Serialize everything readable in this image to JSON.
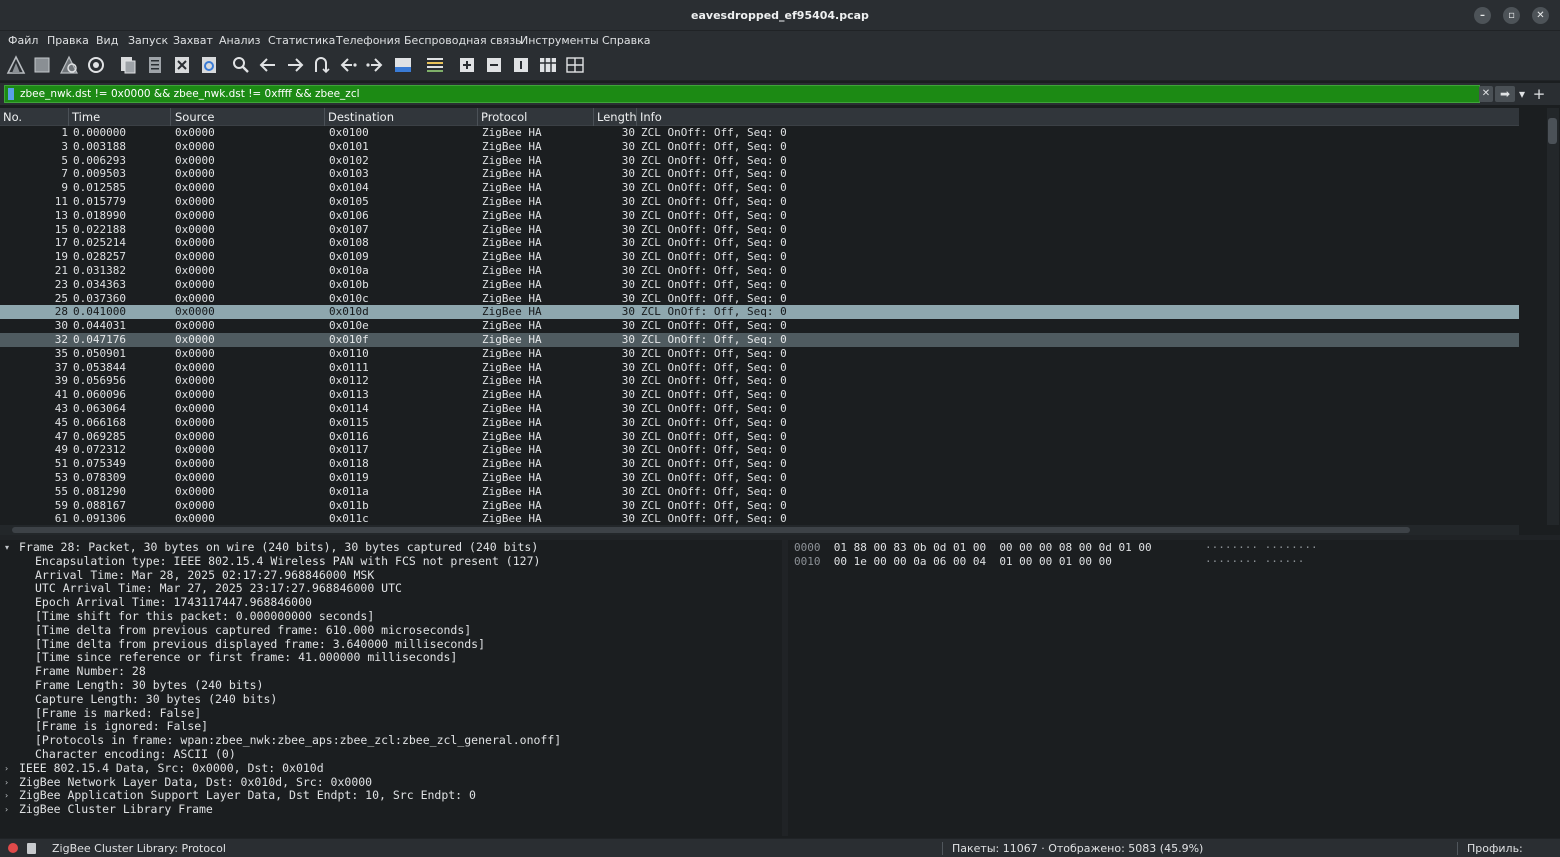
{
  "window": {
    "title": "eavesdropped_ef95404.pcap",
    "minimize": "–",
    "maximize": "▫",
    "close": "✕"
  },
  "menu": [
    "Файл",
    "Правка",
    "Вид",
    "Запуск",
    "Захват",
    "Анализ",
    "Статистика",
    "Телефония",
    "Беспроводная связь",
    "Инструменты",
    "Справка"
  ],
  "toolbar_icons": [
    "shark-start-icon",
    "stop-capture-icon",
    "restart-capture-icon",
    "capture-options-icon",
    "open-file-icon",
    "save-file-icon",
    "close-file-icon",
    "reload-file-icon",
    "find-packet-icon",
    "go-back-icon",
    "go-forward-icon",
    "go-to-packet-icon",
    "first-packet-icon",
    "last-packet-icon",
    "autoscroll-icon",
    "colorize-icon",
    "zoom-in-icon",
    "zoom-out-icon",
    "normal-size-icon",
    "resize-columns-icon",
    "layout-icon"
  ],
  "filter": {
    "expression": "zbee_nwk.dst != 0x0000 && zbee_nwk.dst != 0xffff && zbee_zcl",
    "clear_icon": "✕",
    "apply_icon": "➡",
    "dropdown_icon": "▾",
    "add_icon": "+"
  },
  "columns": [
    "No.",
    "Time",
    "Source",
    "Destination",
    "Protocol",
    "Length",
    "Info"
  ],
  "packets": [
    {
      "no": "1",
      "time": "0.000000",
      "src": "0x0000",
      "dst": "0x0100",
      "proto": "ZigBee HA",
      "len": "30",
      "info": "ZCL OnOff: Off, Seq: 0"
    },
    {
      "no": "3",
      "time": "0.003188",
      "src": "0x0000",
      "dst": "0x0101",
      "proto": "ZigBee HA",
      "len": "30",
      "info": "ZCL OnOff: Off, Seq: 0"
    },
    {
      "no": "5",
      "time": "0.006293",
      "src": "0x0000",
      "dst": "0x0102",
      "proto": "ZigBee HA",
      "len": "30",
      "info": "ZCL OnOff: Off, Seq: 0"
    },
    {
      "no": "7",
      "time": "0.009503",
      "src": "0x0000",
      "dst": "0x0103",
      "proto": "ZigBee HA",
      "len": "30",
      "info": "ZCL OnOff: Off, Seq: 0"
    },
    {
      "no": "9",
      "time": "0.012585",
      "src": "0x0000",
      "dst": "0x0104",
      "proto": "ZigBee HA",
      "len": "30",
      "info": "ZCL OnOff: Off, Seq: 0"
    },
    {
      "no": "11",
      "time": "0.015779",
      "src": "0x0000",
      "dst": "0x0105",
      "proto": "ZigBee HA",
      "len": "30",
      "info": "ZCL OnOff: Off, Seq: 0"
    },
    {
      "no": "13",
      "time": "0.018990",
      "src": "0x0000",
      "dst": "0x0106",
      "proto": "ZigBee HA",
      "len": "30",
      "info": "ZCL OnOff: Off, Seq: 0"
    },
    {
      "no": "15",
      "time": "0.022188",
      "src": "0x0000",
      "dst": "0x0107",
      "proto": "ZigBee HA",
      "len": "30",
      "info": "ZCL OnOff: Off, Seq: 0"
    },
    {
      "no": "17",
      "time": "0.025214",
      "src": "0x0000",
      "dst": "0x0108",
      "proto": "ZigBee HA",
      "len": "30",
      "info": "ZCL OnOff: Off, Seq: 0"
    },
    {
      "no": "19",
      "time": "0.028257",
      "src": "0x0000",
      "dst": "0x0109",
      "proto": "ZigBee HA",
      "len": "30",
      "info": "ZCL OnOff: Off, Seq: 0"
    },
    {
      "no": "21",
      "time": "0.031382",
      "src": "0x0000",
      "dst": "0x010a",
      "proto": "ZigBee HA",
      "len": "30",
      "info": "ZCL OnOff: Off, Seq: 0"
    },
    {
      "no": "23",
      "time": "0.034363",
      "src": "0x0000",
      "dst": "0x010b",
      "proto": "ZigBee HA",
      "len": "30",
      "info": "ZCL OnOff: Off, Seq: 0"
    },
    {
      "no": "25",
      "time": "0.037360",
      "src": "0x0000",
      "dst": "0x010c",
      "proto": "ZigBee HA",
      "len": "30",
      "info": "ZCL OnOff: Off, Seq: 0"
    },
    {
      "no": "28",
      "time": "0.041000",
      "src": "0x0000",
      "dst": "0x010d",
      "proto": "ZigBee HA",
      "len": "30",
      "info": "ZCL OnOff: Off, Seq: 0",
      "state": "selected"
    },
    {
      "no": "30",
      "time": "0.044031",
      "src": "0x0000",
      "dst": "0x010e",
      "proto": "ZigBee HA",
      "len": "30",
      "info": "ZCL OnOff: Off, Seq: 0"
    },
    {
      "no": "32",
      "time": "0.047176",
      "src": "0x0000",
      "dst": "0x010f",
      "proto": "ZigBee HA",
      "len": "30",
      "info": "ZCL OnOff: Off, Seq: 0",
      "state": "hover"
    },
    {
      "no": "35",
      "time": "0.050901",
      "src": "0x0000",
      "dst": "0x0110",
      "proto": "ZigBee HA",
      "len": "30",
      "info": "ZCL OnOff: Off, Seq: 0"
    },
    {
      "no": "37",
      "time": "0.053844",
      "src": "0x0000",
      "dst": "0x0111",
      "proto": "ZigBee HA",
      "len": "30",
      "info": "ZCL OnOff: Off, Seq: 0"
    },
    {
      "no": "39",
      "time": "0.056956",
      "src": "0x0000",
      "dst": "0x0112",
      "proto": "ZigBee HA",
      "len": "30",
      "info": "ZCL OnOff: Off, Seq: 0"
    },
    {
      "no": "41",
      "time": "0.060096",
      "src": "0x0000",
      "dst": "0x0113",
      "proto": "ZigBee HA",
      "len": "30",
      "info": "ZCL OnOff: Off, Seq: 0"
    },
    {
      "no": "43",
      "time": "0.063064",
      "src": "0x0000",
      "dst": "0x0114",
      "proto": "ZigBee HA",
      "len": "30",
      "info": "ZCL OnOff: Off, Seq: 0"
    },
    {
      "no": "45",
      "time": "0.066168",
      "src": "0x0000",
      "dst": "0x0115",
      "proto": "ZigBee HA",
      "len": "30",
      "info": "ZCL OnOff: Off, Seq: 0"
    },
    {
      "no": "47",
      "time": "0.069285",
      "src": "0x0000",
      "dst": "0x0116",
      "proto": "ZigBee HA",
      "len": "30",
      "info": "ZCL OnOff: Off, Seq: 0"
    },
    {
      "no": "49",
      "time": "0.072312",
      "src": "0x0000",
      "dst": "0x0117",
      "proto": "ZigBee HA",
      "len": "30",
      "info": "ZCL OnOff: Off, Seq: 0"
    },
    {
      "no": "51",
      "time": "0.075349",
      "src": "0x0000",
      "dst": "0x0118",
      "proto": "ZigBee HA",
      "len": "30",
      "info": "ZCL OnOff: Off, Seq: 0"
    },
    {
      "no": "53",
      "time": "0.078309",
      "src": "0x0000",
      "dst": "0x0119",
      "proto": "ZigBee HA",
      "len": "30",
      "info": "ZCL OnOff: Off, Seq: 0"
    },
    {
      "no": "55",
      "time": "0.081290",
      "src": "0x0000",
      "dst": "0x011a",
      "proto": "ZigBee HA",
      "len": "30",
      "info": "ZCL OnOff: Off, Seq: 0"
    },
    {
      "no": "59",
      "time": "0.088167",
      "src": "0x0000",
      "dst": "0x011b",
      "proto": "ZigBee HA",
      "len": "30",
      "info": "ZCL OnOff: Off, Seq: 0"
    },
    {
      "no": "61",
      "time": "0.091306",
      "src": "0x0000",
      "dst": "0x011c",
      "proto": "ZigBee HA",
      "len": "30",
      "info": "ZCL OnOff: Off, Seq: 0"
    }
  ],
  "details": [
    {
      "text": "Frame 28: Packet, 30 bytes on wire (240 bits), 30 bytes captured (240 bits)",
      "level": 0,
      "expander": "▾"
    },
    {
      "text": "Encapsulation type: IEEE 802.15.4 Wireless PAN with FCS not present (127)",
      "level": 1
    },
    {
      "text": "Arrival Time: Mar 28, 2025 02:17:27.968846000 MSK",
      "level": 1
    },
    {
      "text": "UTC Arrival Time: Mar 27, 2025 23:17:27.968846000 UTC",
      "level": 1
    },
    {
      "text": "Epoch Arrival Time: 1743117447.968846000",
      "level": 1
    },
    {
      "text": "[Time shift for this packet: 0.000000000 seconds]",
      "level": 1
    },
    {
      "text": "[Time delta from previous captured frame: 610.000 microseconds]",
      "level": 1
    },
    {
      "text": "[Time delta from previous displayed frame: 3.640000 milliseconds]",
      "level": 1
    },
    {
      "text": "[Time since reference or first frame: 41.000000 milliseconds]",
      "level": 1
    },
    {
      "text": "Frame Number: 28",
      "level": 1
    },
    {
      "text": "Frame Length: 30 bytes (240 bits)",
      "level": 1
    },
    {
      "text": "Capture Length: 30 bytes (240 bits)",
      "level": 1
    },
    {
      "text": "[Frame is marked: False]",
      "level": 1
    },
    {
      "text": "[Frame is ignored: False]",
      "level": 1
    },
    {
      "text": "[Protocols in frame: wpan:zbee_nwk:zbee_aps:zbee_zcl:zbee_zcl_general.onoff]",
      "level": 1
    },
    {
      "text": "Character encoding: ASCII (0)",
      "level": 1
    },
    {
      "text": "IEEE 802.15.4 Data, Src: 0x0000, Dst: 0x010d",
      "level": 0,
      "expander": "›"
    },
    {
      "text": "ZigBee Network Layer Data, Dst: 0x010d, Src: 0x0000",
      "level": 0,
      "expander": "›"
    },
    {
      "text": "ZigBee Application Support Layer Data, Dst Endpt: 10, Src Endpt: 0",
      "level": 0,
      "expander": "›"
    },
    {
      "text": "ZigBee Cluster Library Frame",
      "level": 0,
      "expander": "›"
    }
  ],
  "hex": [
    {
      "offset": "0000",
      "bytes": "01 88 00 83 0b 0d 01 00  00 00 00 08 00 0d 01 00",
      "ascii": "········ ········"
    },
    {
      "offset": "0010",
      "bytes": "00 1e 00 00 0a 06 00 04  01 00 00 01 00 00",
      "ascii": "········ ······"
    }
  ],
  "status": {
    "field_info": "ZigBee Cluster Library: Protocol",
    "packets": "Пакеты: 11067 · Отображено: 5083 (45.9%)",
    "profile": "Профиль: Default"
  },
  "colors": {
    "filter_valid_bg": "#1c8a14",
    "selected_row": "#8ea7ae",
    "hover_row": "#4f5b60",
    "background": "#1b1e20"
  }
}
